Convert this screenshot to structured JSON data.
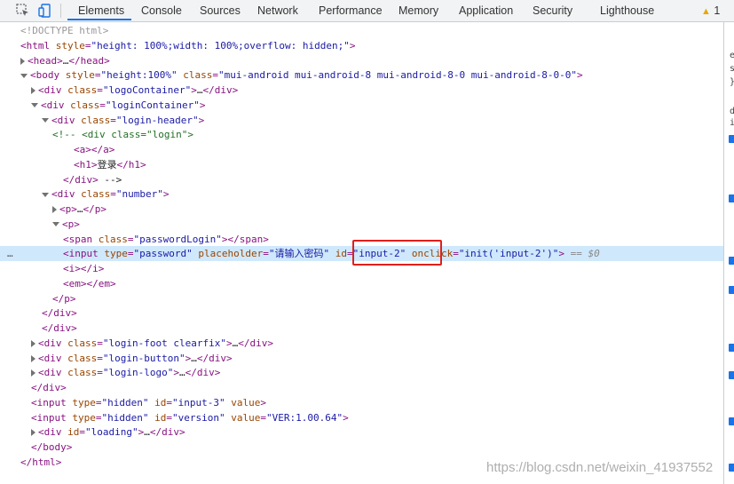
{
  "devtools": {
    "tabs": [
      "Elements",
      "Console",
      "Sources",
      "Network",
      "Performance",
      "Memory",
      "Application",
      "Security",
      "Lighthouse"
    ],
    "active_tab": "Elements",
    "warnings_count": "1",
    "icons": [
      "inspect-element-icon",
      "device-toggle-icon",
      "warning-icon"
    ]
  },
  "dom_lines": [
    {
      "indent": 0,
      "toggle": "",
      "html": "<!DOCTYPE html>"
    },
    {
      "indent": 0,
      "toggle": "",
      "html": "<html style=\"height: 100%;width: 100%;overflow: hidden;\">"
    },
    {
      "indent": 0,
      "toggle": "collapsed",
      "html": "<head>…</head>"
    },
    {
      "indent": 0,
      "toggle": "expanded",
      "html": "<body style=\"height:100%\" class=\"mui-android mui-android-8 mui-android-8-0 mui-android-8-0-0\">"
    },
    {
      "indent": 1,
      "toggle": "collapsed",
      "html": "<div class=\"logoContainer\">…</div>"
    },
    {
      "indent": 1,
      "toggle": "expanded",
      "html": "<div class=\"loginContainer\">"
    },
    {
      "indent": 2,
      "toggle": "expanded",
      "html": "<div class=\"login-header\">"
    },
    {
      "indent": 3,
      "toggle": "",
      "html": "<!-- <div class=\"login\">"
    },
    {
      "indent": 5,
      "toggle": "",
      "html": "<a></a>"
    },
    {
      "indent": 5,
      "toggle": "",
      "html": "<h1>登录</h1>"
    },
    {
      "indent": 4,
      "toggle": "",
      "html": "</div> -->"
    },
    {
      "indent": 2,
      "toggle": "expanded",
      "html": "<div class=\"number\">"
    },
    {
      "indent": 3,
      "toggle": "collapsed",
      "html": "<p>…</p>"
    },
    {
      "indent": 3,
      "toggle": "expanded",
      "html": "<p>"
    },
    {
      "indent": 4,
      "toggle": "",
      "html": "<span class=\"passwordLogin\"></span>"
    },
    {
      "indent": 4,
      "toggle": "",
      "html": "<input type=\"password\" placeholder=\"请输入密码\" id=\"input-2\" onclick=\"init('input-2')\"> == $0",
      "selected": true
    },
    {
      "indent": 4,
      "toggle": "",
      "html": "<i></i>"
    },
    {
      "indent": 4,
      "toggle": "",
      "html": "<em></em>"
    },
    {
      "indent": 3,
      "toggle": "",
      "html": "</p>"
    },
    {
      "indent": 2,
      "toggle": "",
      "html": "</div>"
    },
    {
      "indent": 2,
      "toggle": "",
      "html": "</div>"
    },
    {
      "indent": 1,
      "toggle": "collapsed",
      "html": "<div class=\"login-foot clearfix\">…</div>"
    },
    {
      "indent": 1,
      "toggle": "collapsed",
      "html": "<div class=\"login-button\">…</div>"
    },
    {
      "indent": 1,
      "toggle": "collapsed",
      "html": "<div class=\"login-logo\">…</div>"
    },
    {
      "indent": 1,
      "toggle": "",
      "html": "</div>"
    },
    {
      "indent": 1,
      "toggle": "",
      "html": "<input type=\"hidden\" id=\"input-3\" value>"
    },
    {
      "indent": 1,
      "toggle": "",
      "html": "<input type=\"hidden\" id=\"version\" value=\"VER:1.00.64\">"
    },
    {
      "indent": 1,
      "toggle": "collapsed",
      "html": "<div id=\"loading\">…</div>"
    },
    {
      "indent": 1,
      "toggle": "",
      "html": "</body>"
    },
    {
      "indent": 0,
      "toggle": "",
      "html": "</html>"
    }
  ],
  "selected_line_marker": "…",
  "watermark": "https://blog.csdn.net/weixin_41937552",
  "right_pane_fragments": [
    "e",
    "s",
    "}",
    "d",
    "i"
  ],
  "colors": {
    "tag": "#881280",
    "attr_name": "#994500",
    "attr_value": "#1a1aa6",
    "comment": "#236e25",
    "highlight_box": "#e0201b",
    "selected_row": "#cfe8fc",
    "tab_underline": "#1a73e8"
  }
}
